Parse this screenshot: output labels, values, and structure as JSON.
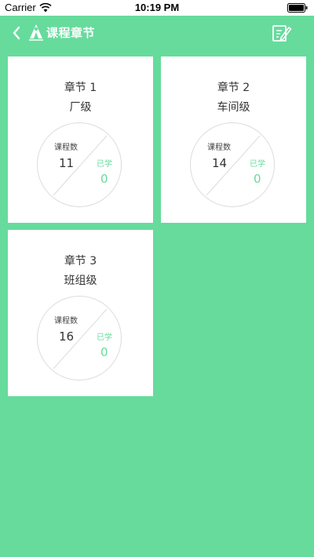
{
  "status_bar": {
    "carrier": "Carrier",
    "time": "10:19 PM"
  },
  "nav": {
    "title": "课程章节"
  },
  "icons": {
    "back": "chevron-left-icon",
    "logo": "app-logo-icon",
    "edit": "edit-note-icon"
  },
  "colors": {
    "background": "#66db9c",
    "accent": "#66db9c",
    "card": "#ffffff"
  },
  "labels": {
    "course_count": "课程数",
    "learned": "已学"
  },
  "chapters": [
    {
      "title": "章节 1",
      "level": "厂级",
      "course_count": "11",
      "learned": "0"
    },
    {
      "title": "章节 2",
      "level": "车间级",
      "course_count": "14",
      "learned": "0"
    },
    {
      "title": "章节 3",
      "level": "班组级",
      "course_count": "16",
      "learned": "0"
    }
  ]
}
